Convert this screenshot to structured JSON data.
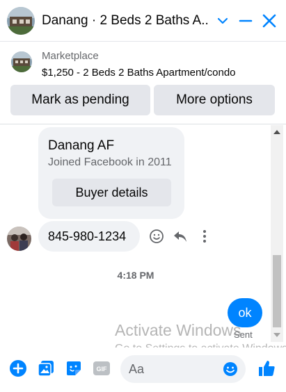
{
  "header": {
    "title": "Danang · 2 Beds 2 Baths A...",
    "accent_color": "#0084ff",
    "icons": [
      "chevron-down-icon",
      "minimize-icon",
      "close-icon"
    ]
  },
  "listing": {
    "label": "Marketplace",
    "price_title": "$1,250 - 2 Beds 2 Baths Apartment/condo",
    "mark_pending_label": "Mark as pending",
    "more_options_label": "More options"
  },
  "conversation": {
    "profile": {
      "name": "Danang AF",
      "joined": "Joined Facebook in 2011",
      "buyer_details_label": "Buyer details"
    },
    "message_phone": "845-980-1234",
    "timestamp": "4:18 PM",
    "message_ok": "ok",
    "sent_status": "Sent"
  },
  "watermark": {
    "line1": "Activate Windows",
    "line2": "Go to Settings to activate Windows."
  },
  "composer": {
    "placeholder": "Aa",
    "icons": [
      "add-icon",
      "photo-icon",
      "sticker-icon",
      "gif-icon",
      "emoji-icon",
      "like-icon"
    ]
  }
}
